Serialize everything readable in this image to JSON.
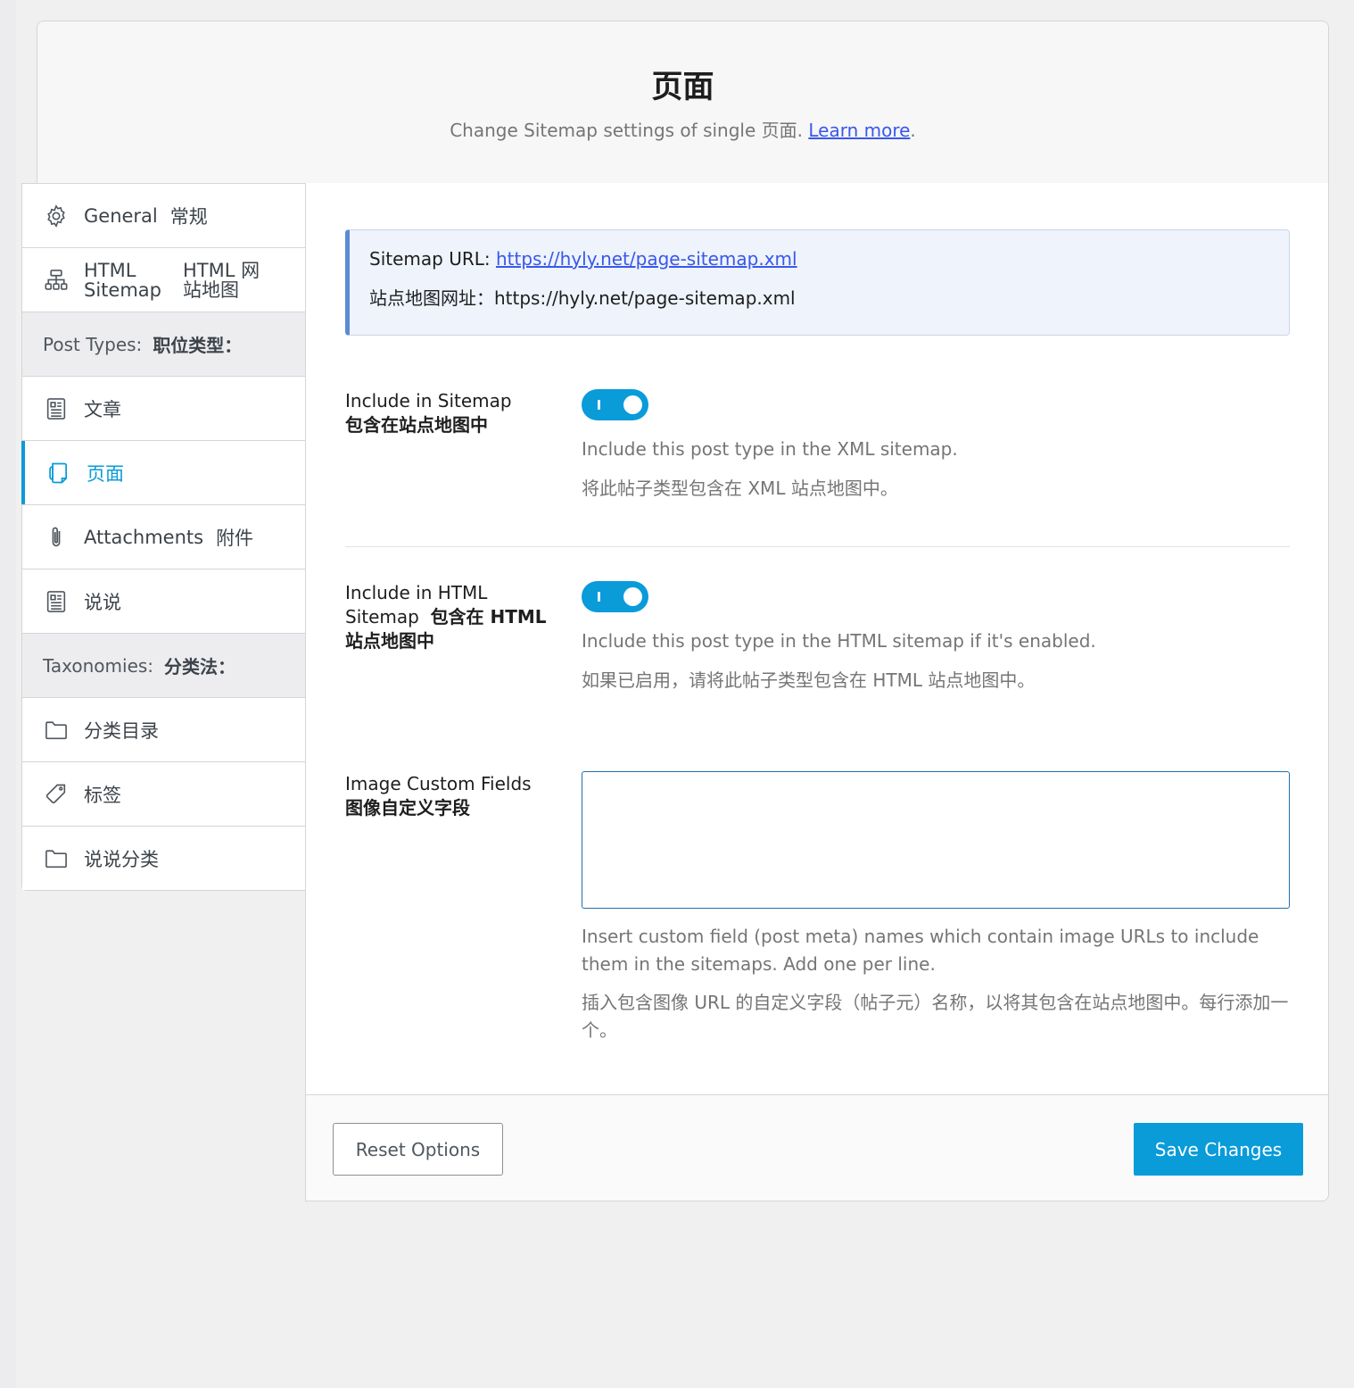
{
  "header": {
    "title": "页面",
    "subtitle_prefix": "Change Sitemap settings of single 页面.",
    "learn_more": "Learn more",
    "subtitle_suffix": "."
  },
  "sidebar": {
    "general": {
      "label": "General",
      "label_zh": "常规"
    },
    "html_sitemap": {
      "line1": "HTML",
      "line2": "Sitemap",
      "zh_line1": "HTML 网",
      "zh_line2": "站地图"
    },
    "post_types_section": {
      "label": "Post Types:",
      "label_zh": "职位类型："
    },
    "posts": {
      "label": "文章"
    },
    "pages": {
      "label": "页面"
    },
    "attachments": {
      "label": "Attachments",
      "label_zh": "附件"
    },
    "shuoshuo": {
      "label": "说说"
    },
    "taxonomies_section": {
      "label": "Taxonomies:",
      "label_zh": "分类法："
    },
    "categories": {
      "label": "分类目录"
    },
    "tags": {
      "label": "标签"
    },
    "shuoshuo_category": {
      "label": "说说分类"
    }
  },
  "notice": {
    "url_label": "Sitemap URL:",
    "url": "https://hyly.net/page-sitemap.xml",
    "url_label_zh": "站点地图网址：",
    "url_zh": "https://hyly.net/page-sitemap.xml"
  },
  "include_sitemap": {
    "label": "Include in Sitemap",
    "label_zh": "包含在站点地图中",
    "enabled": true,
    "desc": "Include this post type in the XML sitemap.",
    "desc_zh": "将此帖子类型包含在 XML 站点地图中。"
  },
  "include_html": {
    "label": "Include in HTML Sitemap",
    "label_zh": "包含在 HTML 站点地图中",
    "enabled": true,
    "desc": "Include this post type in the HTML sitemap if it's enabled.",
    "desc_zh": "如果已启用，请将此帖子类型包含在 HTML 站点地图中。"
  },
  "image_fields": {
    "label": "Image Custom Fields",
    "label_zh": "图像自定义字段",
    "value": "",
    "desc": "Insert custom field (post meta) names which contain image URLs to include them in the sitemaps. Add one per line.",
    "desc_zh": "插入包含图像 URL 的自定义字段（帖子元）名称，以将其包含在站点地图中。每行添加一个。"
  },
  "footer": {
    "reset": "Reset Options",
    "save": "Save Changes"
  },
  "colors": {
    "accent": "#0a9bd9",
    "link": "#3858e9",
    "notice_border": "#5b8bd6"
  }
}
